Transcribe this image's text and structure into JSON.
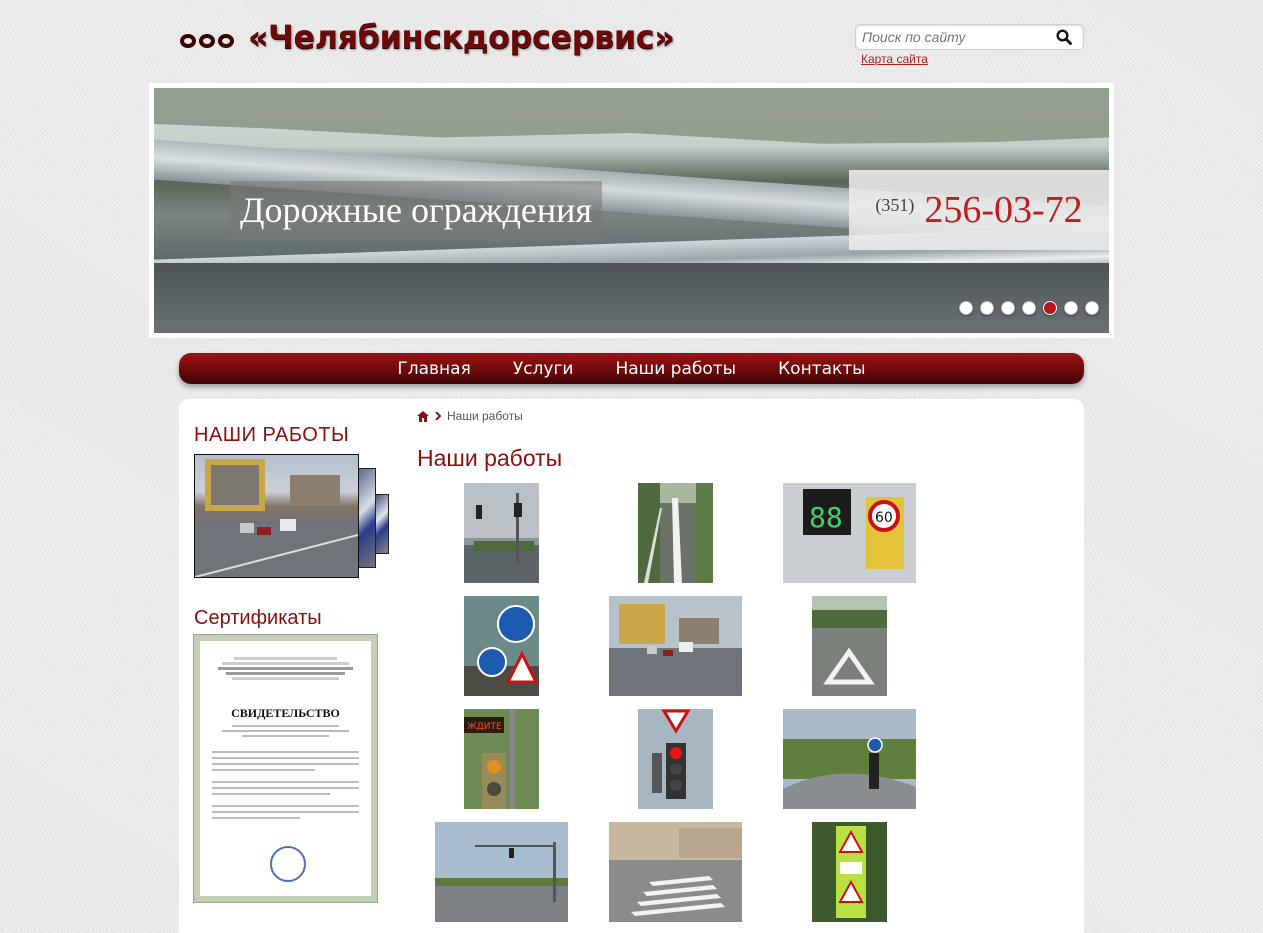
{
  "header": {
    "logo_prefix": "ООО",
    "logo_name": "«Челябинскдорсервис»",
    "search_placeholder": "Поиск по сайту",
    "sitemap_link": "Карта сайта"
  },
  "slider": {
    "caption": "Дорожные ограждения",
    "phone_code": "(351)",
    "phone_number": "256-03-72",
    "dot_count": 7,
    "active_dot": 5
  },
  "nav": {
    "items": [
      {
        "label": "Главная"
      },
      {
        "label": "Услуги"
      },
      {
        "label": "Наши работы"
      },
      {
        "label": "Контакты"
      }
    ]
  },
  "sidebar": {
    "works_title": "НАШИ РАБОТЫ",
    "certs_title": "Сертификаты",
    "certificate_heading": "СВИДЕТЕЛЬСТВО"
  },
  "breadcrumb": {
    "current": "Наши работы"
  },
  "main": {
    "title": "Наши работы"
  },
  "colors": {
    "brand_red": "#8a0f10",
    "phone_red": "#c8191b",
    "link_red": "#b0201e"
  }
}
